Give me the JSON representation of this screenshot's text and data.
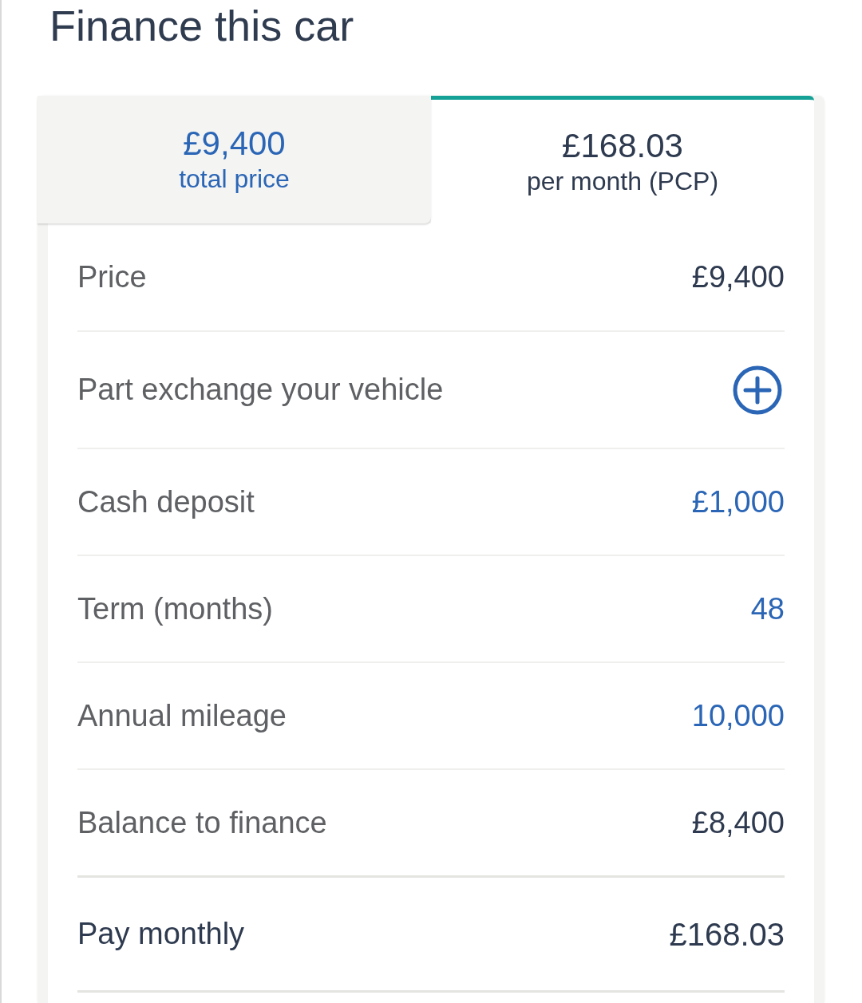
{
  "title": "Finance this car",
  "tabs": [
    {
      "amount": "£9,400",
      "caption": "total price",
      "selected": false
    },
    {
      "amount": "£168.03",
      "caption": "per month (PCP)",
      "selected": true
    }
  ],
  "rows": [
    {
      "kind": "static",
      "label": "Price",
      "value": "£9,400"
    },
    {
      "kind": "add",
      "label": "Part exchange your vehicle"
    },
    {
      "kind": "editable",
      "label": "Cash deposit",
      "value": "£1,000"
    },
    {
      "kind": "editable",
      "label": "Term (months)",
      "value": "48"
    },
    {
      "kind": "editable",
      "label": "Annual mileage",
      "value": "10,000"
    },
    {
      "kind": "static",
      "label": "Balance to finance",
      "value": "£8,400"
    },
    {
      "kind": "total",
      "label": "Pay monthly",
      "value": "£168.03"
    }
  ]
}
